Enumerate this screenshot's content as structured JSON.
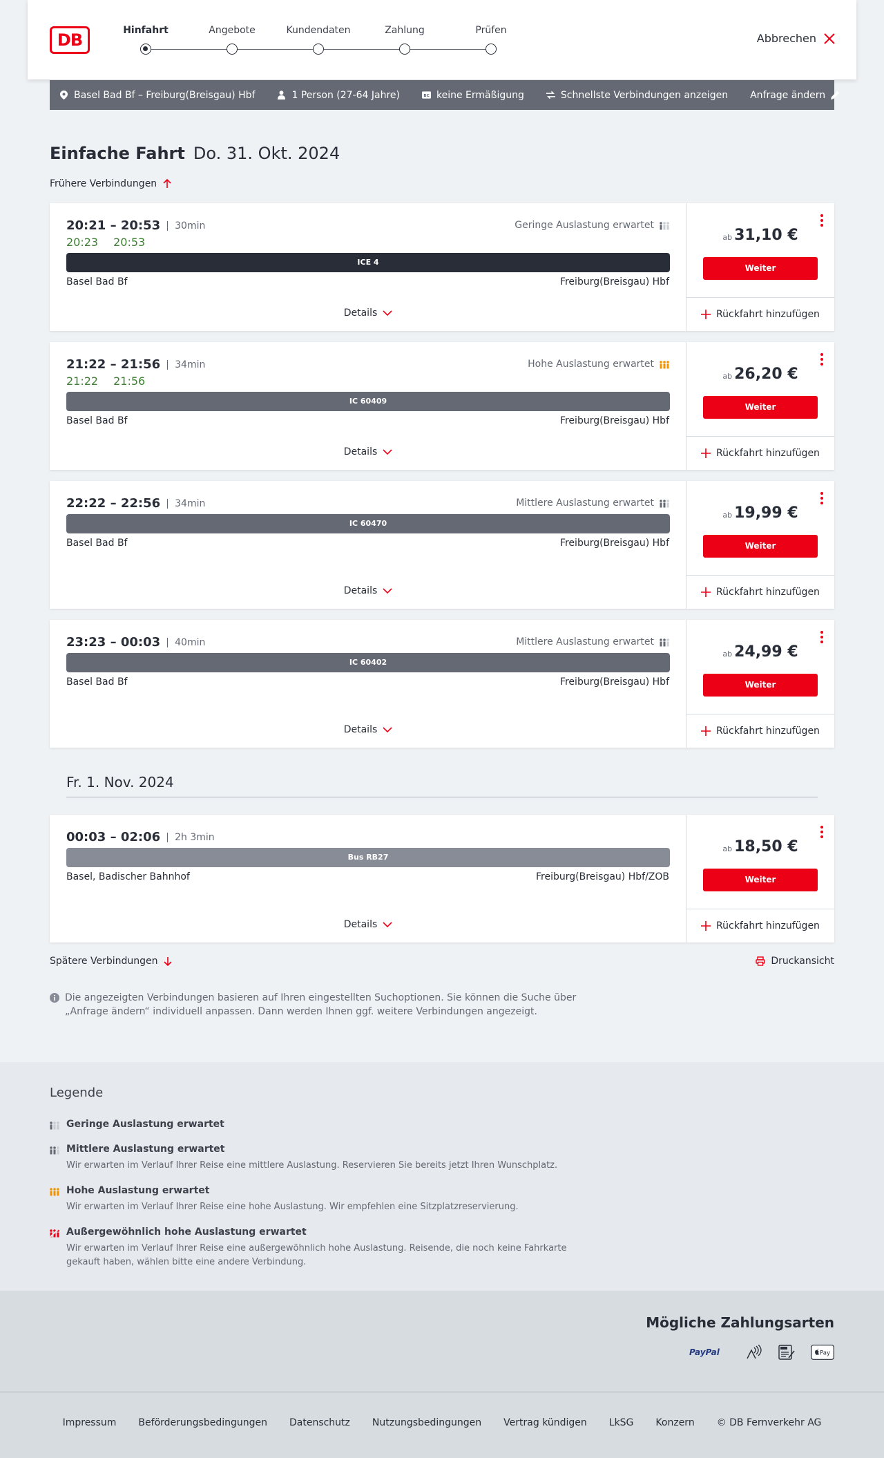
{
  "header": {
    "logo_text": "DB",
    "steps": [
      "Hinfahrt",
      "Angebote",
      "Kundendaten",
      "Zahlung",
      "Prüfen"
    ],
    "cancel_label": "Abbrechen"
  },
  "search": {
    "route": "Basel Bad Bf – Freiburg(Breisgau) Hbf",
    "persons": "1 Person (27-64 Jahre)",
    "discount": "keine Ermäßigung",
    "fastest": "Schnellste Verbindungen anzeigen",
    "edit": "Anfrage ändern"
  },
  "title": {
    "trip_type": "Einfache Fahrt",
    "date": "Do. 31. Okt. 2024"
  },
  "earlier_label": "Frühere Verbindungen",
  "later_label": "Spätere Verbindungen",
  "print_label": "Druckansicht",
  "date_separator": "Fr. 1. Nov. 2024",
  "connections": [
    {
      "time": "20:21 – 20:53",
      "duration": "30min",
      "rt_dep": "20:23",
      "rt_arr": "20:53",
      "load": "Geringe Auslastung erwartet",
      "train": "ICE 4",
      "from": "Basel Bad Bf",
      "to": "Freiburg(Breisgau) Hbf",
      "ab": "ab",
      "price": "31,10 €",
      "details": "Details",
      "weiter": "Weiter",
      "return": "Rückfahrt hinzufügen"
    },
    {
      "time": "21:22 – 21:56",
      "duration": "34min",
      "rt_dep": "21:22",
      "rt_arr": "21:56",
      "load": "Hohe Auslastung erwartet",
      "train": "IC 60409",
      "from": "Basel Bad Bf",
      "to": "Freiburg(Breisgau) Hbf",
      "ab": "ab",
      "price": "26,20 €",
      "details": "Details",
      "weiter": "Weiter",
      "return": "Rückfahrt hinzufügen"
    },
    {
      "time": "22:22 – 22:56",
      "duration": "34min",
      "load": "Mittlere Auslastung erwartet",
      "train": "IC 60470",
      "from": "Basel Bad Bf",
      "to": "Freiburg(Breisgau) Hbf",
      "ab": "ab",
      "price": "19,99 €",
      "details": "Details",
      "weiter": "Weiter",
      "return": "Rückfahrt hinzufügen"
    },
    {
      "time": "23:23 – 00:03",
      "duration": "40min",
      "load": "Mittlere Auslastung erwartet",
      "train": "IC 60402",
      "from": "Basel Bad Bf",
      "to": "Freiburg(Breisgau) Hbf",
      "ab": "ab",
      "price": "24,99 €",
      "details": "Details",
      "weiter": "Weiter",
      "return": "Rückfahrt hinzufügen"
    },
    {
      "time": "00:03 – 02:06",
      "duration": "2h 3min",
      "train": "Bus RB27",
      "from": "Basel, Badischer Bahnhof",
      "to": "Freiburg(Breisgau) Hbf/ZOB",
      "ab": "ab",
      "price": "18,50 €",
      "details": "Details",
      "weiter": "Weiter",
      "return": "Rückfahrt hinzufügen"
    }
  ],
  "info_text": "Die angezeigten Verbindungen basieren auf Ihren eingestellten Suchoptionen. Sie können die Suche über „Anfrage ändern“ individuell anpassen. Dann werden Ihnen ggf. weitere Verbindungen angezeigt.",
  "legend": {
    "title": "Legende",
    "items": [
      {
        "title": "Geringe Auslastung erwartet",
        "desc": ""
      },
      {
        "title": "Mittlere Auslastung erwartet",
        "desc": "Wir erwarten im Verlauf Ihrer Reise eine mittlere Auslastung. Reservieren Sie bereits jetzt Ihren Wunschplatz."
      },
      {
        "title": "Hohe Auslastung erwartet",
        "desc": "Wir erwarten im Verlauf Ihrer Reise eine hohe Auslastung. Wir empfehlen eine Sitzplatzreservierung."
      },
      {
        "title": "Außergewöhnlich hohe Auslastung erwartet",
        "desc": "Wir erwarten im Verlauf Ihrer Reise eine außergewöhnlich hohe Auslastung. Reisende, die noch keine Fahrkarte gekauft haben, wählen bitte eine andere Verbindung."
      }
    ]
  },
  "payment": {
    "title": "Mögliche Zahlungsarten",
    "methods": [
      "PayPal",
      "Pay"
    ]
  },
  "footer": [
    "Impressum",
    "Beförderungsbedingungen",
    "Datenschutz",
    "Nutzungsbedingungen",
    "Vertrag kündigen",
    "LkSG",
    "Konzern",
    "© DB Fernverkehr AG"
  ],
  "colors": {
    "brand_red": "#ec0016",
    "realtime_green": "#408335",
    "load_orange": "#f39200",
    "train_dark": "#282d37",
    "train_gray": "#646973",
    "bus_gray": "#878c96"
  }
}
